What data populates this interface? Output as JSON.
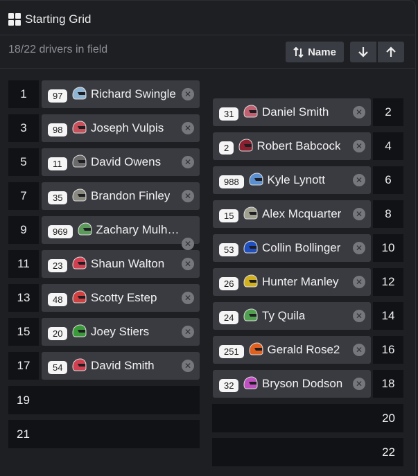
{
  "header": {
    "title": "Starting Grid",
    "count_text": "18/22 drivers in field"
  },
  "toolbar": {
    "sort_label": "Name"
  },
  "left": {
    "slots": [
      {
        "pos": "1",
        "num": "97",
        "name": "Richard Swingle",
        "color": "#8fb4d4"
      },
      {
        "pos": "3",
        "num": "98",
        "name": "Joseph Vulpis",
        "color": "#c8505a"
      },
      {
        "pos": "5",
        "num": "11",
        "name": "David Owens",
        "color": "#6a6a6a"
      },
      {
        "pos": "7",
        "num": "35",
        "name": "Brandon Finley",
        "color": "#8a8a80"
      },
      {
        "pos": "9",
        "num": "969",
        "name": "Zachary Mulhe…",
        "color": "#5c9a5c"
      },
      {
        "pos": "11",
        "num": "23",
        "name": "Shaun Walton",
        "color": "#d04050"
      },
      {
        "pos": "13",
        "num": "48",
        "name": "Scotty Estep",
        "color": "#d04040"
      },
      {
        "pos": "15",
        "num": "20",
        "name": "Joey Stiers",
        "color": "#3a9a3a"
      },
      {
        "pos": "17",
        "num": "54",
        "name": "David Smith",
        "color": "#d04050"
      }
    ],
    "empty": [
      "19",
      "21"
    ]
  },
  "right": {
    "slots": [
      {
        "pos": "2",
        "num": "31",
        "name": "Daniel Smith",
        "color": "#c06070"
      },
      {
        "pos": "4",
        "num": "2",
        "name": "Robert Babcock",
        "color": "#8a2030"
      },
      {
        "pos": "6",
        "num": "988",
        "name": "Kyle Lynott",
        "color": "#5a8fd0"
      },
      {
        "pos": "8",
        "num": "15",
        "name": "Alex Mcquarter",
        "color": "#a0a090"
      },
      {
        "pos": "10",
        "num": "53",
        "name": "Collin Bollinger",
        "color": "#2050c0"
      },
      {
        "pos": "12",
        "num": "26",
        "name": "Hunter Manley",
        "color": "#d0b020"
      },
      {
        "pos": "14",
        "num": "24",
        "name": "Ty Quila",
        "color": "#50a050"
      },
      {
        "pos": "16",
        "num": "251",
        "name": "Gerald Rose2",
        "color": "#e06020"
      },
      {
        "pos": "18",
        "num": "32",
        "name": "Bryson Dodson",
        "color": "#c050c0"
      }
    ],
    "empty": [
      "20",
      "22"
    ]
  }
}
